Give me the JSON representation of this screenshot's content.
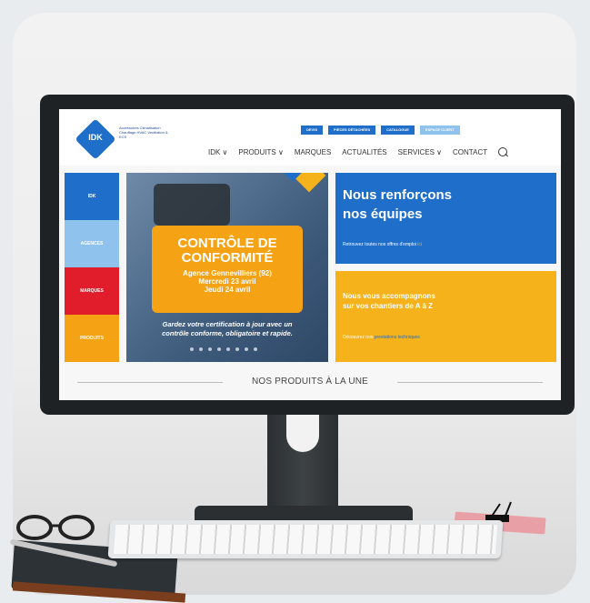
{
  "header": {
    "logo_text": "IDK",
    "tagline": "Accessoires Climatisation Chauffage HVAC Ventilation & ECS",
    "top_buttons": [
      "DEVIS",
      "PIÈCES DÉTACHÉES",
      "CATALOGUE",
      "ESPACE CLIENT"
    ],
    "nav": [
      "IDK ∨",
      "PRODUITS ∨",
      "MARQUES",
      "ACTUALITÉS",
      "SERVICES ∨",
      "CONTACT"
    ]
  },
  "sidebar": {
    "items": [
      {
        "label": "IDK",
        "color": "#1f6ec9"
      },
      {
        "label": "AGENCES",
        "color": "#8fc3ee"
      },
      {
        "label": "MARQUES",
        "color": "#e11d2b"
      },
      {
        "label": "PRODUITS",
        "color": "#f5a214"
      }
    ]
  },
  "hero": {
    "title": "CONTRÔLE DE\nCONFORMITÉ",
    "line1": "Agence Gennevilliers (92)",
    "line2": "Mercredi 23 avril",
    "line3": "Jeudi 24 avril",
    "caption": "Gardez votre certification à jour avec un\ncontrôle conforme, obligatoire et rapide."
  },
  "promo1": {
    "title": "Nous renforçons\nnos équipes",
    "text": "Retrouvez toutes nos offres d'emploi",
    "link": "ici"
  },
  "promo2": {
    "title": "Nous vous accompagnons\nsur vos chantiers de A à Z",
    "text": "Découvrez nos",
    "link": "prestations techniques"
  },
  "section": {
    "title": "NOS PRODUITS À LA UNE"
  }
}
